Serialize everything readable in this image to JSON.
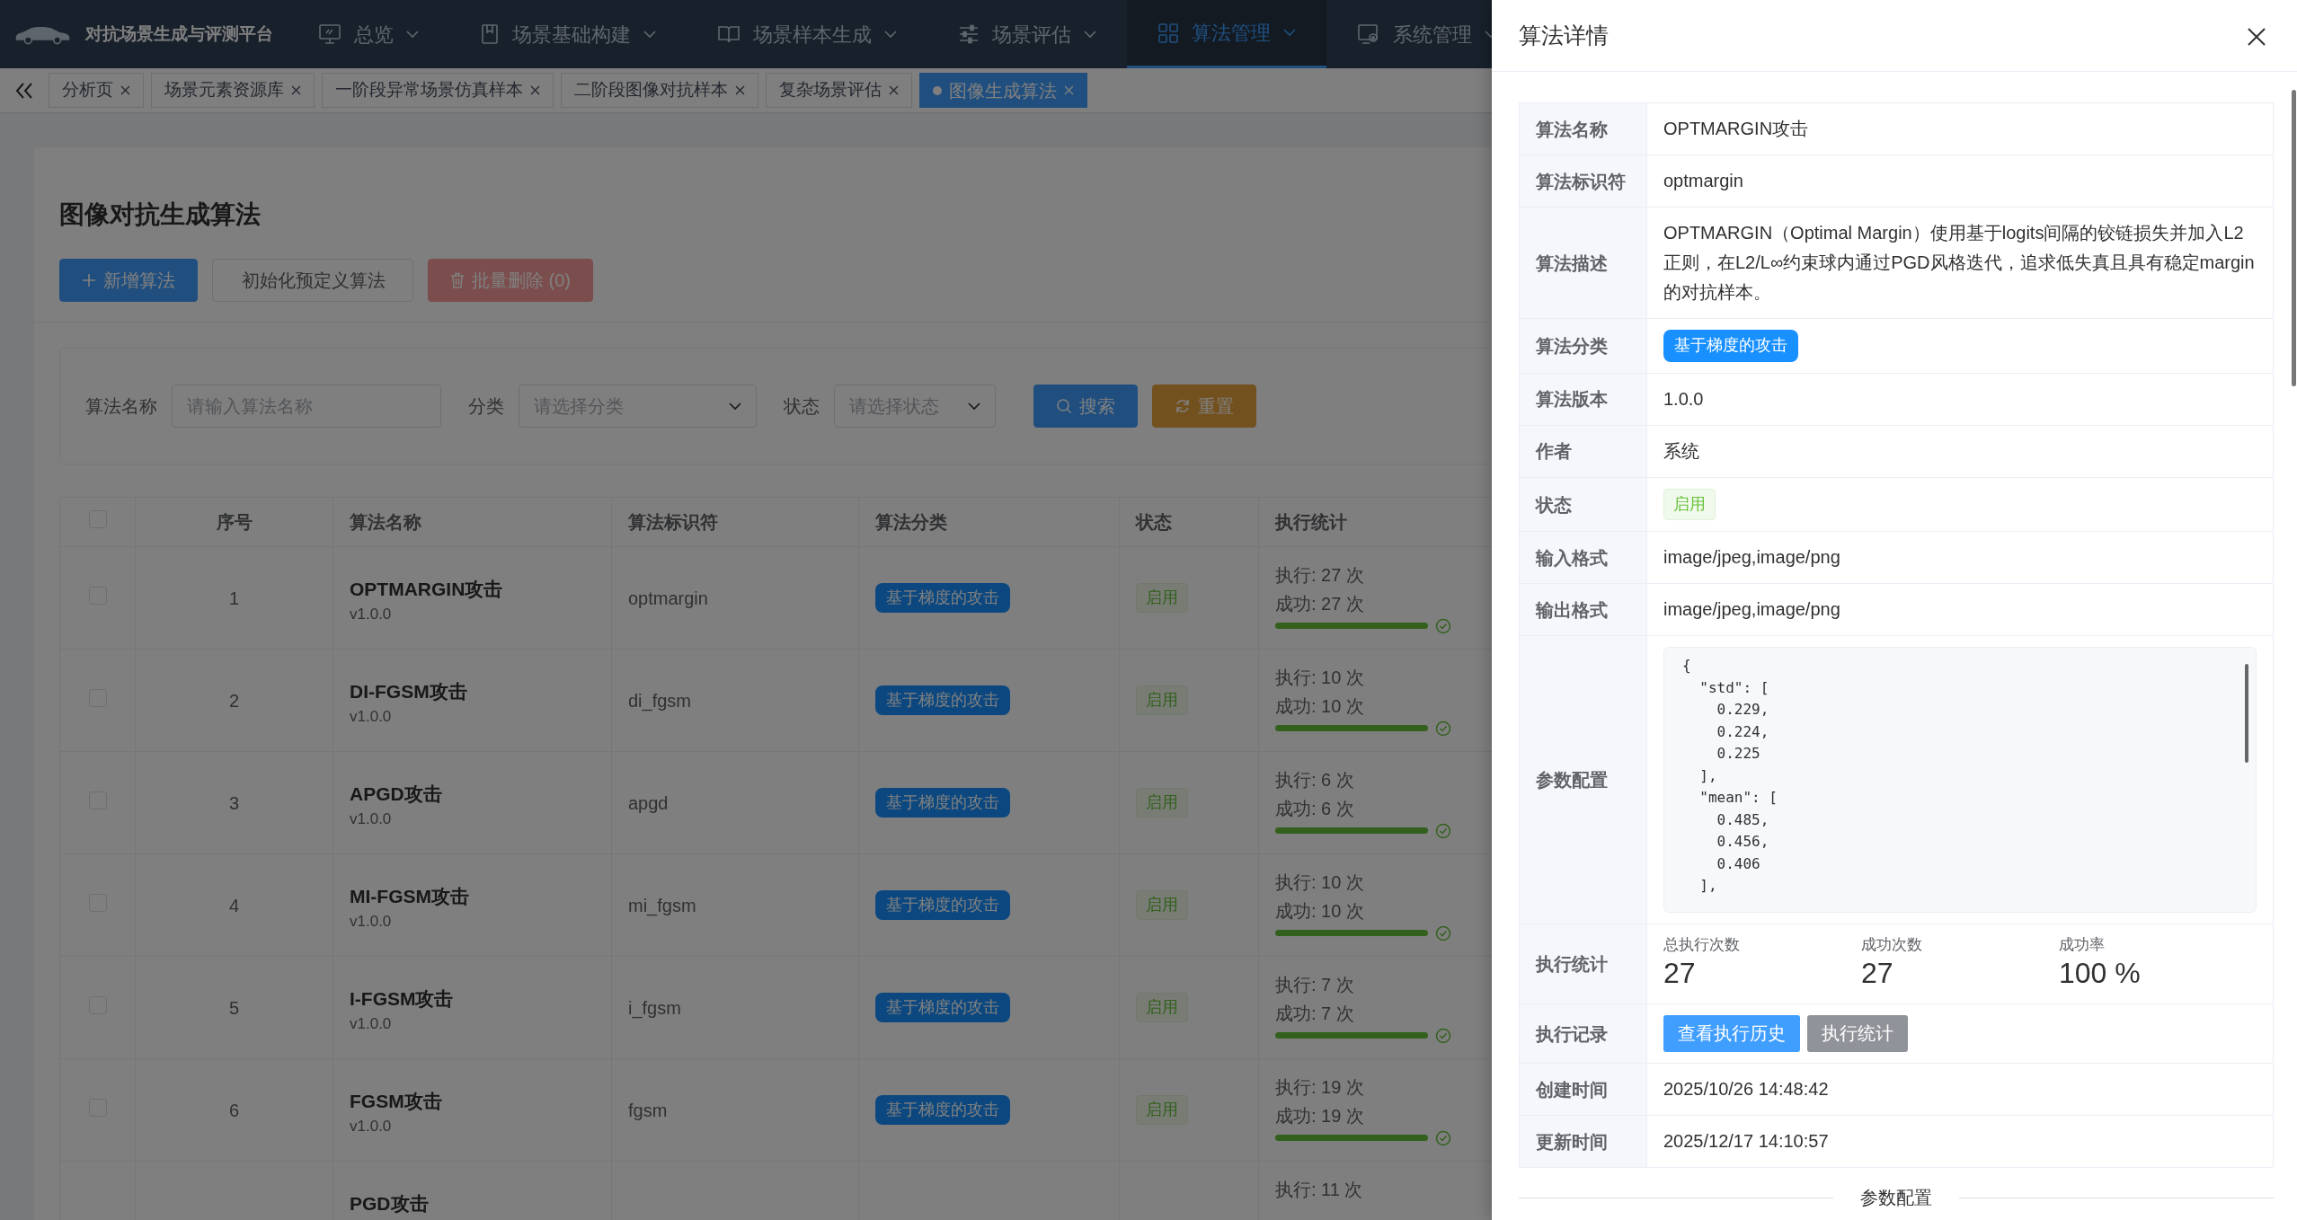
{
  "app": {
    "title": "对抗场景生成与评测平台"
  },
  "nav": [
    {
      "label": "总览",
      "selected": false
    },
    {
      "label": "场景基础构建",
      "selected": false
    },
    {
      "label": "场景样本生成",
      "selected": false
    },
    {
      "label": "场景评估",
      "selected": false
    },
    {
      "label": "算法管理",
      "selected": true
    },
    {
      "label": "系统管理",
      "selected": false
    }
  ],
  "tabs": [
    {
      "label": "分析页",
      "selected": false
    },
    {
      "label": "场景元素资源库",
      "selected": false
    },
    {
      "label": "一阶段异常场景仿真样本",
      "selected": false
    },
    {
      "label": "二阶段图像对抗样本",
      "selected": false
    },
    {
      "label": "复杂场景评估",
      "selected": false
    },
    {
      "label": "图像生成算法",
      "selected": true
    }
  ],
  "page": {
    "title": "图像对抗生成算法",
    "buttons": [
      {
        "label": "新增算法",
        "kind": "primary"
      },
      {
        "label": "初始化预定义算法",
        "kind": "default"
      },
      {
        "label": "批量删除 (0)",
        "kind": "danger",
        "disabled": true
      }
    ]
  },
  "filters": [
    {
      "label": "算法名称",
      "kind": "text",
      "placeholder": "请输入算法名称"
    },
    {
      "label": "分类",
      "kind": "select",
      "placeholder": "请选择分类"
    },
    {
      "label": "状态",
      "kind": "select",
      "placeholder": "请选择状态"
    }
  ],
  "filter_buttons": [
    {
      "label": "搜索",
      "kind": "search"
    },
    {
      "label": "重置",
      "kind": "reset"
    }
  ],
  "table": {
    "all_checked": false,
    "columns": [
      "序号",
      "算法名称",
      "算法标识符",
      "算法分类",
      "状态",
      "执行统计"
    ],
    "rows": [
      {
        "checked": false,
        "index": "1",
        "name": "OPTMARGIN攻击",
        "version": "v1.0.0",
        "identifier": "optmargin",
        "category": "基于梯度的攻击",
        "status": "启用",
        "runs": "执行: 27 次",
        "successes": "成功: 27 次",
        "level": 1
      },
      {
        "checked": false,
        "index": "2",
        "name": "DI-FGSM攻击",
        "version": "v1.0.0",
        "identifier": "di_fgsm",
        "category": "基于梯度的攻击",
        "status": "启用",
        "runs": "执行: 10 次",
        "successes": "成功: 10 次",
        "level": 1
      },
      {
        "checked": false,
        "index": "3",
        "name": "APGD攻击",
        "version": "v1.0.0",
        "identifier": "apgd",
        "category": "基于梯度的攻击",
        "status": "启用",
        "runs": "执行: 6 次",
        "successes": "成功: 6 次",
        "level": 1
      },
      {
        "checked": false,
        "index": "4",
        "name": "MI-FGSM攻击",
        "version": "v1.0.0",
        "identifier": "mi_fgsm",
        "category": "基于梯度的攻击",
        "status": "启用",
        "runs": "执行: 10 次",
        "successes": "成功: 10 次",
        "level": 1
      },
      {
        "checked": false,
        "index": "5",
        "name": "I-FGSM攻击",
        "version": "v1.0.0",
        "identifier": "i_fgsm",
        "category": "基于梯度的攻击",
        "status": "启用",
        "runs": "执行: 7 次",
        "successes": "成功: 7 次",
        "level": 1
      },
      {
        "checked": false,
        "index": "6",
        "name": "FGSM攻击",
        "version": "v1.0.0",
        "identifier": "fgsm",
        "category": "基于梯度的攻击",
        "status": "启用",
        "runs": "执行: 19 次",
        "successes": "成功: 19 次",
        "level": 1
      },
      {
        "name": "PGD攻击",
        "runs": "执行: 11 次"
      }
    ]
  },
  "drawer": {
    "title": "算法详情",
    "section": "参数配置",
    "fields": [
      {
        "label": "算法名称",
        "kind": "text",
        "value": "OPTMARGIN攻击"
      },
      {
        "label": "算法标识符",
        "kind": "text",
        "value": "optmargin"
      },
      {
        "label": "算法描述",
        "kind": "text",
        "value": "OPTMARGIN（Optimal Margin）使用基于logits间隔的铰链损失并加入L2正则，在L2/L∞约束球内通过PGD风格迭代，追求低失真且具有稳定margin的对抗样本。"
      },
      {
        "label": "算法分类",
        "kind": "tag",
        "value": "基于梯度的攻击"
      },
      {
        "label": "算法版本",
        "kind": "text",
        "value": "1.0.0"
      },
      {
        "label": "作者",
        "kind": "text",
        "value": "系统"
      },
      {
        "label": "状态",
        "kind": "status",
        "value": "启用"
      },
      {
        "label": "输入格式",
        "kind": "text",
        "value": "image/jpeg,image/png"
      },
      {
        "label": "输出格式",
        "kind": "text",
        "value": "image/jpeg,image/png"
      },
      {
        "label": "参数配置",
        "kind": "code",
        "value": "{\n  \"std\": [\n    0.229,\n    0.224,\n    0.225\n  ],\n  \"mean\": [\n    0.485,\n    0.456,\n    0.406\n  ],"
      },
      {
        "label": "执行统计",
        "kind": "stats",
        "stats": [
          {
            "title": "总执行次数",
            "value": "27"
          },
          {
            "title": "成功次数",
            "value": "27"
          },
          {
            "title": "成功率",
            "value": "100 %"
          }
        ]
      },
      {
        "label": "执行记录",
        "kind": "buttons",
        "buttons": [
          {
            "label": "查看执行历史",
            "kind": "primary"
          },
          {
            "label": "执行统计",
            "kind": "secondary"
          }
        ]
      },
      {
        "label": "创建时间",
        "kind": "text",
        "value": "2025/10/26 14:48:42"
      },
      {
        "label": "更新时间",
        "kind": "text",
        "value": "2025/12/17 14:10:57"
      }
    ]
  }
}
